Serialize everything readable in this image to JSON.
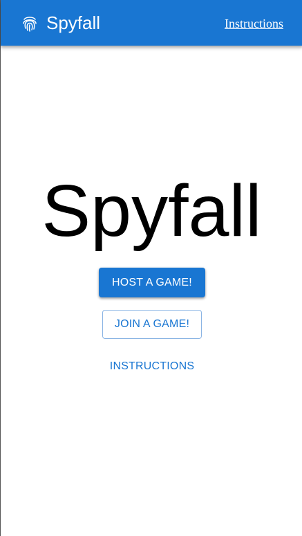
{
  "appbar": {
    "brand_icon": "fingerprint-icon",
    "title": "Spyfall",
    "nav_link": "Instructions"
  },
  "main": {
    "title": "Spyfall",
    "host_button": "HOST A GAME!",
    "join_button": "JOIN A GAME!",
    "instructions_button": "INSTRUCTIONS"
  },
  "colors": {
    "primary": "#1976d2",
    "background": "#ffffff",
    "text": "#000000"
  }
}
